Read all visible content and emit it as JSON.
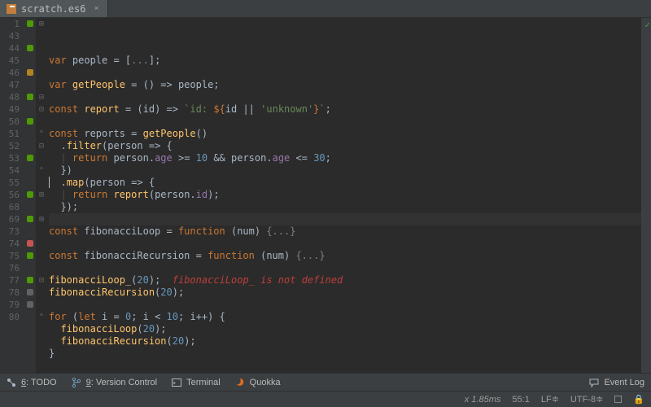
{
  "tab": {
    "filename": "scratch.es6"
  },
  "gutter_numbers": [
    "1",
    "43",
    "44",
    "45",
    "46",
    "47",
    "48",
    "49",
    "50",
    "51",
    "55",
    "56",
    "68",
    "69",
    "73",
    "74",
    "75",
    "76",
    "77",
    "78",
    "79",
    "80",
    "52",
    "53",
    "54"
  ],
  "lines": [
    {
      "n": "1",
      "mark": "green",
      "fold": "plus",
      "tokens": [
        [
          "kw",
          "var "
        ],
        [
          "def",
          "people "
        ],
        [
          "pun",
          "= ["
        ],
        [
          "fold",
          "..."
        ],
        [
          "pun",
          "];"
        ]
      ]
    },
    {
      "n": "43",
      "mark": "none",
      "fold": "",
      "tokens": []
    },
    {
      "n": "44",
      "mark": "green",
      "fold": "",
      "tokens": [
        [
          "kw",
          "var "
        ],
        [
          "fn",
          "getPeople"
        ],
        [
          "def",
          " = () => people;"
        ]
      ]
    },
    {
      "n": "45",
      "mark": "none",
      "fold": "",
      "tokens": []
    },
    {
      "n": "46",
      "mark": "orange",
      "fold": "",
      "tokens": [
        [
          "kw",
          "const "
        ],
        [
          "fn",
          "report"
        ],
        [
          "def",
          " = (id) => "
        ],
        [
          "str",
          "`id: "
        ],
        [
          "kw",
          "${"
        ],
        [
          "def",
          "id || "
        ],
        [
          "str",
          "'unknown'"
        ],
        [
          "kw",
          "}"
        ],
        [
          "str",
          "`"
        ],
        [
          "pun",
          ";"
        ]
      ]
    },
    {
      "n": "47",
      "mark": "none",
      "fold": "",
      "tokens": []
    },
    {
      "n": "48",
      "mark": "green",
      "fold": "minus",
      "tokens": [
        [
          "kw",
          "const "
        ],
        [
          "def",
          "reports = "
        ],
        [
          "fn",
          "getPeople"
        ],
        [
          "pun",
          "()"
        ]
      ]
    },
    {
      "n": "49",
      "mark": "none",
      "fold": "minus",
      "tokens": [
        [
          "def",
          "  ."
        ],
        [
          "fn",
          "filter"
        ],
        [
          "pun",
          "("
        ],
        [
          "def",
          "person => {"
        ]
      ]
    },
    {
      "n": "50",
      "mark": "green",
      "fold": "",
      "tokens": [
        [
          "guide",
          "  | "
        ],
        [
          "kw",
          "return "
        ],
        [
          "def",
          "person."
        ],
        [
          "prop",
          "age"
        ],
        [
          "def",
          " >= "
        ],
        [
          "num",
          "10"
        ],
        [
          "def",
          " && person."
        ],
        [
          "prop",
          "age"
        ],
        [
          "def",
          " <= "
        ],
        [
          "num",
          "30"
        ],
        [
          "pun",
          ";"
        ]
      ]
    },
    {
      "n": "51",
      "mark": "none",
      "fold": "up",
      "tokens": [
        [
          "def",
          "  })"
        ]
      ]
    },
    {
      "n": "52",
      "mark": "none",
      "fold": "minus",
      "tokens": [
        [
          "def",
          "  ."
        ],
        [
          "fn",
          "map"
        ],
        [
          "pun",
          "("
        ],
        [
          "def",
          "person => {"
        ]
      ]
    },
    {
      "n": "53",
      "mark": "green",
      "fold": "",
      "tokens": [
        [
          "guide",
          "  | "
        ],
        [
          "kw",
          "return "
        ],
        [
          "fn",
          "report"
        ],
        [
          "pun",
          "("
        ],
        [
          "def",
          "person."
        ],
        [
          "prop",
          "id"
        ],
        [
          "pun",
          ");"
        ]
      ]
    },
    {
      "n": "54",
      "mark": "none",
      "fold": "up",
      "tokens": [
        [
          "def",
          "  });"
        ]
      ]
    },
    {
      "n": "55",
      "mark": "none",
      "fold": "",
      "current": true,
      "tokens": []
    },
    {
      "n": "56",
      "mark": "green",
      "fold": "plus",
      "tokens": [
        [
          "kw",
          "const "
        ],
        [
          "def",
          "fibonacciLoop = "
        ],
        [
          "kw",
          "function"
        ],
        [
          "def",
          " (num) "
        ],
        [
          "fold",
          "{...}"
        ]
      ]
    },
    {
      "n": "68",
      "mark": "none",
      "fold": "",
      "tokens": []
    },
    {
      "n": "69",
      "mark": "green",
      "fold": "plus",
      "tokens": [
        [
          "kw",
          "const "
        ],
        [
          "def",
          "fibonacciRecursion = "
        ],
        [
          "kw",
          "function"
        ],
        [
          "def",
          " (num) "
        ],
        [
          "fold",
          "{...}"
        ]
      ]
    },
    {
      "n": "73",
      "mark": "none",
      "fold": "",
      "tokens": []
    },
    {
      "n": "74",
      "mark": "red",
      "fold": "",
      "tokens": [
        [
          "fn",
          "fibonacciLoop_"
        ],
        [
          "pun",
          "("
        ],
        [
          "num",
          "20"
        ],
        [
          "pun",
          ");  "
        ],
        [
          "err",
          "fibonacciLoop_ is not defined"
        ]
      ]
    },
    {
      "n": "75",
      "mark": "green",
      "fold": "",
      "tokens": [
        [
          "fn",
          "fibonacciRecursion"
        ],
        [
          "pun",
          "("
        ],
        [
          "num",
          "20"
        ],
        [
          "pun",
          ");"
        ]
      ]
    },
    {
      "n": "76",
      "mark": "none",
      "fold": "",
      "tokens": []
    },
    {
      "n": "77",
      "mark": "green",
      "fold": "minus",
      "tokens": [
        [
          "kw",
          "for"
        ],
        [
          "def",
          " ("
        ],
        [
          "kw",
          "let"
        ],
        [
          "def",
          " i = "
        ],
        [
          "num",
          "0"
        ],
        [
          "def",
          "; i < "
        ],
        [
          "num",
          "10"
        ],
        [
          "def",
          "; i++) {"
        ]
      ]
    },
    {
      "n": "78",
      "mark": "gray",
      "fold": "",
      "tokens": [
        [
          "def",
          "  "
        ],
        [
          "fn",
          "fibonacciLoop"
        ],
        [
          "pun",
          "("
        ],
        [
          "num",
          "20"
        ],
        [
          "pun",
          ");"
        ]
      ]
    },
    {
      "n": "79",
      "mark": "gray",
      "fold": "",
      "tokens": [
        [
          "def",
          "  "
        ],
        [
          "fn",
          "fibonacciRecursion"
        ],
        [
          "pun",
          "("
        ],
        [
          "num",
          "20"
        ],
        [
          "pun",
          ");"
        ]
      ]
    },
    {
      "n": "80",
      "mark": "none",
      "fold": "up",
      "tokens": [
        [
          "def",
          "}"
        ]
      ]
    }
  ],
  "tools": {
    "todo": "6: TODO",
    "vcs": "9: Version Control",
    "terminal": "Terminal",
    "quokka": "Quokka",
    "eventlog": "Event Log"
  },
  "status": {
    "timing": "x 1.85ms",
    "pos": "55:1",
    "lineend": "LF",
    "encoding": "UTF-8"
  },
  "glyphs": {
    "fold_plus": "⊞",
    "fold_minus": "⊟",
    "fold_up": "⌃",
    "dropdown": "≑",
    "check": "✓",
    "lock": "🔒",
    "close": "×"
  }
}
